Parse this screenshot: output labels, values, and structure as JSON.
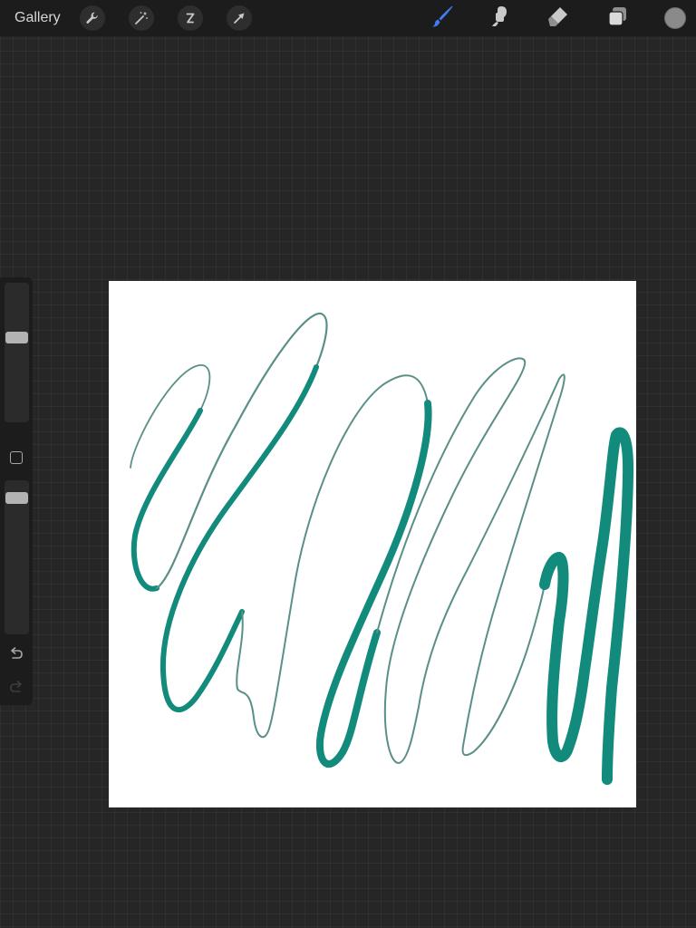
{
  "topbar": {
    "gallery_label": "Gallery",
    "left_tools": [
      {
        "icon": "wrench-icon",
        "name": "actions"
      },
      {
        "icon": "magic-wand-icon",
        "name": "adjustments"
      },
      {
        "icon": "selection-s-icon",
        "name": "selection"
      },
      {
        "icon": "arrow-cursor-icon",
        "name": "transform"
      }
    ],
    "right_tools": [
      {
        "icon": "brush-icon",
        "name": "brush",
        "active": true
      },
      {
        "icon": "smudge-icon",
        "name": "smudge"
      },
      {
        "icon": "eraser-icon",
        "name": "eraser"
      },
      {
        "icon": "layers-icon",
        "name": "layers"
      }
    ],
    "current_color": "#8a8a8a"
  },
  "sidebar": {
    "brush_size_level": 0.62,
    "brush_opacity_level": 0.92,
    "modify_button": "square-icon",
    "undo_icon": "undo-icon",
    "redo_icon": "redo-icon"
  },
  "canvas": {
    "background": "#ffffff",
    "stroke_color_light": "#5a8f88",
    "stroke_color_bold": "#128a7c"
  }
}
